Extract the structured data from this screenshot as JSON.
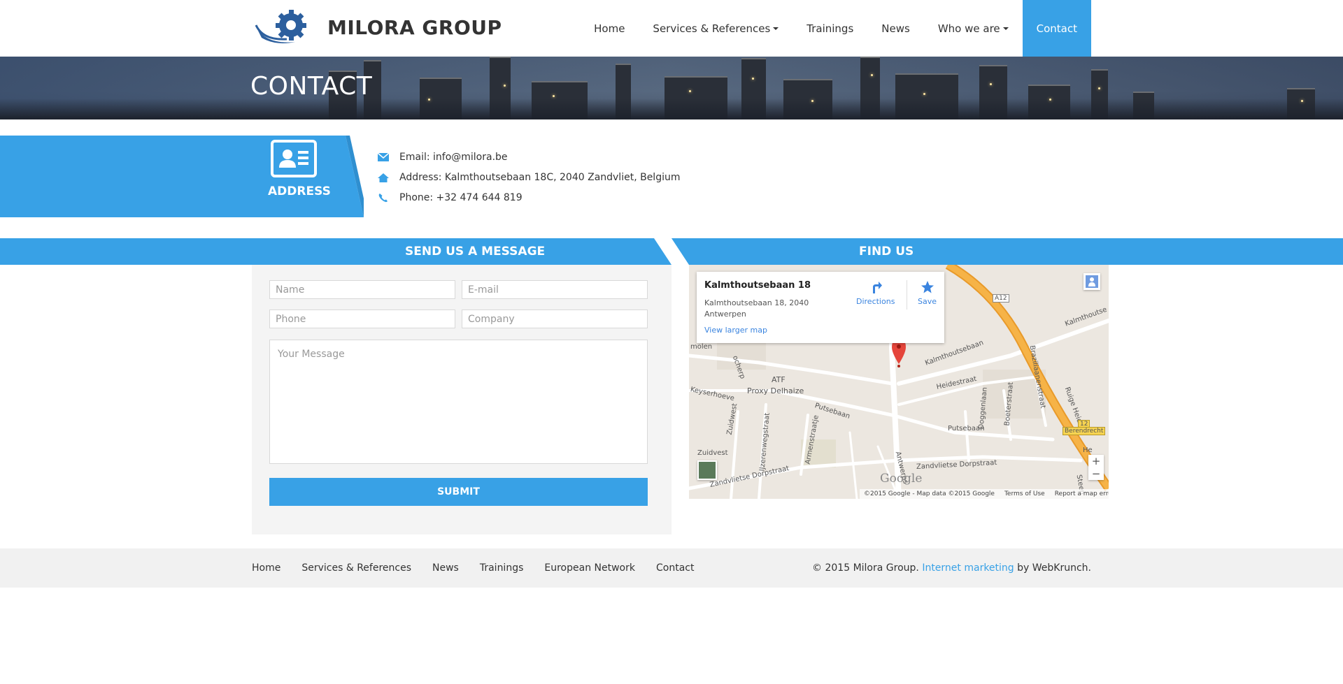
{
  "brand": {
    "name": "MILORA GROUP",
    "logo_icon": "gear-logo-icon",
    "colors": {
      "accent": "#38a1e6",
      "logo_blue": "#2c5f9e"
    }
  },
  "nav": {
    "items": [
      {
        "label": "Home"
      },
      {
        "label": "Services & References",
        "dropdown": true
      },
      {
        "label": "Trainings"
      },
      {
        "label": "News"
      },
      {
        "label": "Who we are",
        "dropdown": true
      },
      {
        "label": "Contact",
        "active": true
      }
    ]
  },
  "banner": {
    "title": "CONTACT"
  },
  "address": {
    "title": "ADDRESS",
    "icon": "contact-card-icon",
    "rows": [
      {
        "icon": "mail-icon",
        "text": "Email: info@milora.be"
      },
      {
        "icon": "home-icon",
        "text": "Address: Kalmthoutsebaan 18C, 2040 Zandvliet, Belgium"
      },
      {
        "icon": "phone-icon",
        "text": "Phone: +32 474 644 819"
      }
    ]
  },
  "form": {
    "title": "SEND US A MESSAGE",
    "name_placeholder": "Name",
    "email_placeholder": "E-mail",
    "phone_placeholder": "Phone",
    "company_placeholder": "Company",
    "message_placeholder": "Your Message",
    "submit_label": "SUBMIT"
  },
  "map": {
    "title": "FIND US",
    "card": {
      "place": "Kalmthoutsebaan 18",
      "address": "Kalmthoutsebaan 18, 2040 Antwerpen",
      "directions": "Directions",
      "save": "Save",
      "larger": "View larger map"
    },
    "labels": {
      "kalmthoutsebaan": "Kalmthoutsebaan",
      "kalmthoutse_edge": "Kalmthoutse",
      "heidestraat": "Heidestraat",
      "putsebaan_left": "Putsebaan",
      "putsebaan_right": "Putsebaan",
      "proxy": "Proxy Delhaize",
      "atf": "ATF",
      "keyserhoeve": "Keyserhoeve",
      "zuidwest": "Zuidwest",
      "zuidvest": "Zuidvest",
      "ijzerenweg": "IJzerenwegstraat",
      "armenstraatje": "Armenstraatje",
      "zandvliet_left": "Zandvlietse Dorpstraat",
      "zandvliet_right": "Zandvlietse Dorpstraat",
      "antwerp": "Antwerps",
      "doggenlaan": "Doggenlaan",
      "boeterstraat": "Boeterstraat",
      "brazilianen": "Braziliaanenstraat",
      "ruige": "Ruige Heide",
      "a12": "A12",
      "r12": "12",
      "berendrecht": "Berendrecht",
      "molen": "molen",
      "ocherp": "ocherp",
      "steen": "Steen",
      "he": "He"
    },
    "zoom_in": "+",
    "zoom_out": "−",
    "google": "Google",
    "footer": {
      "data": "©2015 Google - Map data ©2015 Google",
      "terms": "Terms of Use",
      "report": "Report a map error"
    }
  },
  "footer": {
    "links": [
      "Home",
      "Services & References",
      "News",
      "Trainings",
      "European Network",
      "Contact"
    ],
    "copy_prefix": "© 2015 Milora Group. ",
    "copy_link": "Internet marketing",
    "copy_suffix": " by WebKrunch."
  }
}
